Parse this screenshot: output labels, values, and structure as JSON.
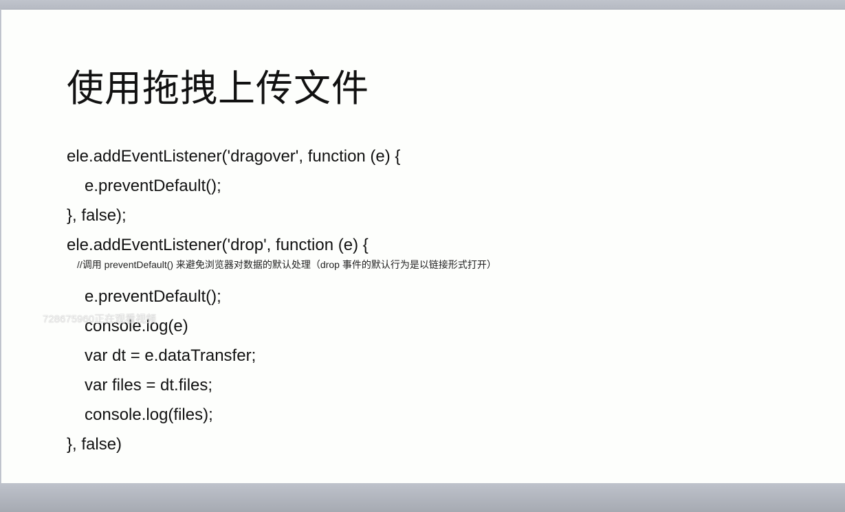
{
  "slide": {
    "title": "使用拖拽上传文件",
    "code_lines": [
      "ele.addEventListener('dragover', function (e) {",
      "e.preventDefault();",
      "}, false);",
      "ele.addEventListener('drop', function (e) {",
      "e.preventDefault();",
      "console.log(e)",
      "var dt = e.dataTransfer;",
      "var files = dt.files;",
      "console.log(files);",
      "}, false)"
    ],
    "comment": "//调用 preventDefault() 来避免浏览器对数据的默认处理（drop 事件的默认行为是以链接形式打开）"
  },
  "watermark": "728675960正在观看视频"
}
